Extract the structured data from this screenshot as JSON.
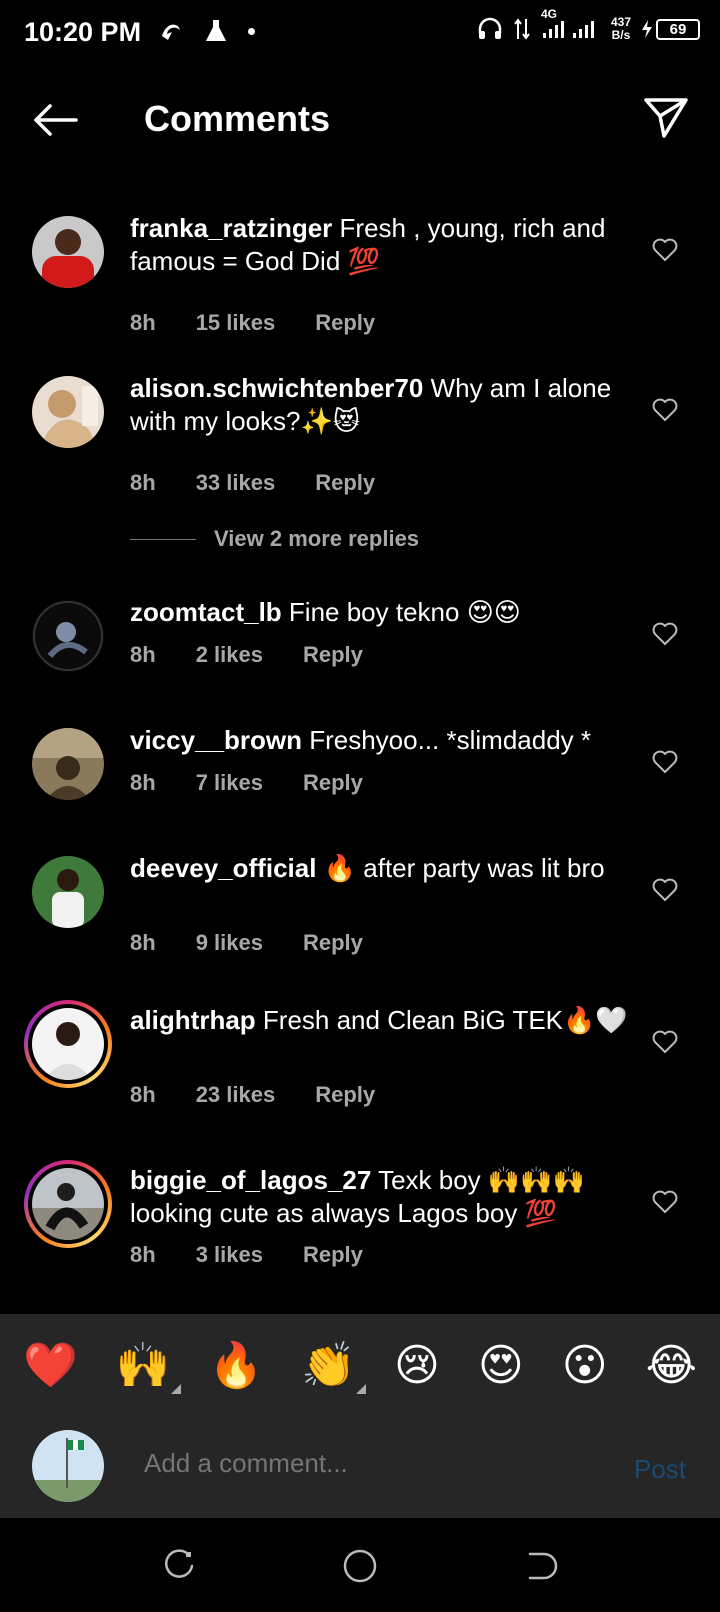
{
  "status_bar": {
    "time": "10:20 PM",
    "network": "4G",
    "rate_top": "437",
    "rate_bottom": "B/s",
    "battery": "69"
  },
  "header": {
    "title": "Comments"
  },
  "comments": [
    {
      "user": "franka_ratzinger",
      "text": "Fresh , young, rich and famous = God Did 💯",
      "time": "8h",
      "likes": "15 likes",
      "reply": "Reply"
    },
    {
      "user": "alison.schwichtenber70",
      "text": "Why am I alone with my looks?✨😻",
      "time": "8h",
      "likes": "33 likes",
      "reply": "Reply"
    },
    {
      "user": "zoomtact_lb",
      "text": "Fine boy tekno 😍😍",
      "time": "8h",
      "likes": "2 likes",
      "reply": "Reply"
    },
    {
      "user": "viccy__brown",
      "text": "Freshyoo... *slimdaddy *",
      "time": "8h",
      "likes": "7 likes",
      "reply": "Reply"
    },
    {
      "user": "deevey_official",
      "text": "🔥 after party was lit bro",
      "time": "8h",
      "likes": "9 likes",
      "reply": "Reply"
    },
    {
      "user": "alightrhap",
      "text": "Fresh and Clean BiG TEK🔥🤍",
      "time": "8h",
      "likes": "23 likes",
      "reply": "Reply"
    },
    {
      "user": "biggie_of_lagos_27",
      "text": "Texk boy 🙌🙌🙌 looking cute as always Lagos boy 💯",
      "time": "8h",
      "likes": "3 likes",
      "reply": "Reply"
    }
  ],
  "view_replies": "View 2 more replies",
  "emojis": [
    "❤️",
    "🙌",
    "🔥",
    "👏",
    "😢",
    "😍",
    "😮",
    "😂"
  ],
  "compose": {
    "placeholder": "Add a comment...",
    "post_label": "Post"
  }
}
